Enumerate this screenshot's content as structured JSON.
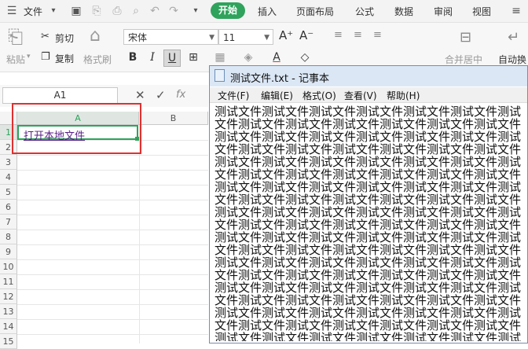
{
  "menubar": {
    "file_label": "文件",
    "tabs": [
      "开始",
      "插入",
      "页面布局",
      "公式",
      "数据",
      "审阅",
      "视图"
    ]
  },
  "ribbon": {
    "paste": "粘贴",
    "cut": "剪切",
    "copy": "复制",
    "format_painter": "格式刷",
    "font_name": "宋体",
    "font_size": "11",
    "merge_center": "合并居中",
    "auto_wrap": "自动换"
  },
  "formula": {
    "cell_ref": "A1",
    "fx": "fx"
  },
  "sheet": {
    "columns": [
      "A",
      "B"
    ],
    "rows": [
      "1",
      "2",
      "3",
      "4",
      "5",
      "6",
      "7",
      "8",
      "9",
      "10",
      "11",
      "12",
      "13",
      "14",
      "15"
    ],
    "a1_value": "打开本地文件"
  },
  "notepad": {
    "title": "测试文件.txt - 记事本",
    "menus": [
      "文件(F)",
      "编辑(E)",
      "格式(O)",
      "查看(V)",
      "帮助(H)"
    ],
    "content": "测试文件测试文件测试文件测试文件测试文件测试文件测试文件测试文件测试文件测试文件测试文件测试文件测试文件测试文件测试文件测试文件测试文件测试文件测试文件测试文件测试文件测试文件测试文件测试文件测试文件测试文件测试文件测试文件测试文件测试文件测试文件测试文件测试文件测试文件测试文件测试文件测试文件测试文件测试文件测试文件测试文件测试文件测试文件测试文件测试文件测试文件测试文件测试文件测试文件测试文件测试文件测试文件测试文件测试文件测试文件测试文件测试文件测试文件测试文件测试文件测试文件测试文件测试文件测试文件测试文件测试文件测试文件测试文件测试文件测试文件测试文件测试文件测试文件测试文件测试文件测试文件测试文件测试文件测试文件测试文件测试文件测试文件测试文件测试文件测试文件测试文件测试文件测试文件测试文件测试文件测试文件测试文件测试文件测试文件测试文件测试文件测试文件测试文件测试文件测试文件测试文件测试文件测试文件测试文件测试文件测试文件测试文件测试文件测试文件测试文件测试文件测试文件测试文件测试文件测试文件测试文件测试文件测试文件测试文件测试文件测试文件测试文件测试文件测试文件测试文件测试文件测试文件测试文件测试文件测试文件测试文件测试文件测试文件测试文件测试文件测试文件测试文件测试文件测试文件测试文件测试文件测试文件测试文件测试文件测试文件测试文件测试文件测试文件测试文件测试文件测试文件测试文件测试文件测试文件测试文件"
  },
  "colors": {
    "accent": "#2fa35c",
    "highlight": "#e03030",
    "link": "#5a1f8a"
  }
}
